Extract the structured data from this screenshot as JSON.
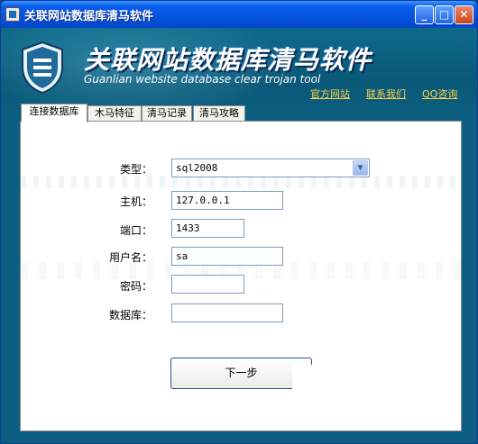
{
  "window": {
    "title": "关联网站数据库清马软件"
  },
  "title_buttons": {
    "minimize": "_",
    "maximize": "□",
    "close": "✕"
  },
  "banner": {
    "title": "关联网站数据库清马软件",
    "subtitle": "Guanlian website  database clear  trojan tool",
    "logo_icon": "shield-logo-icon"
  },
  "links": [
    {
      "label": "官方网站"
    },
    {
      "label": "联系我们"
    },
    {
      "label": "QQ咨询"
    }
  ],
  "tabs": [
    {
      "label": "连接数据库",
      "active": true
    },
    {
      "label": "木马特征",
      "active": false
    },
    {
      "label": "清马记录",
      "active": false
    },
    {
      "label": "清马攻略",
      "active": false
    }
  ],
  "form": {
    "type_label": "类型：",
    "type_value": "sql2008",
    "host_label": "主机：",
    "host_value": "127.0.0.1",
    "port_label": "端口：",
    "port_value": "1433",
    "user_label": "用户名：",
    "user_value": "sa",
    "password_label": "密码：",
    "password_value": "",
    "database_label": "数据库：",
    "database_value": ""
  },
  "next_button": {
    "label": "下一步"
  },
  "colors": {
    "titlebar": "#0553e0",
    "banner_bg": "#0a5878",
    "link": "#ffd24a"
  }
}
